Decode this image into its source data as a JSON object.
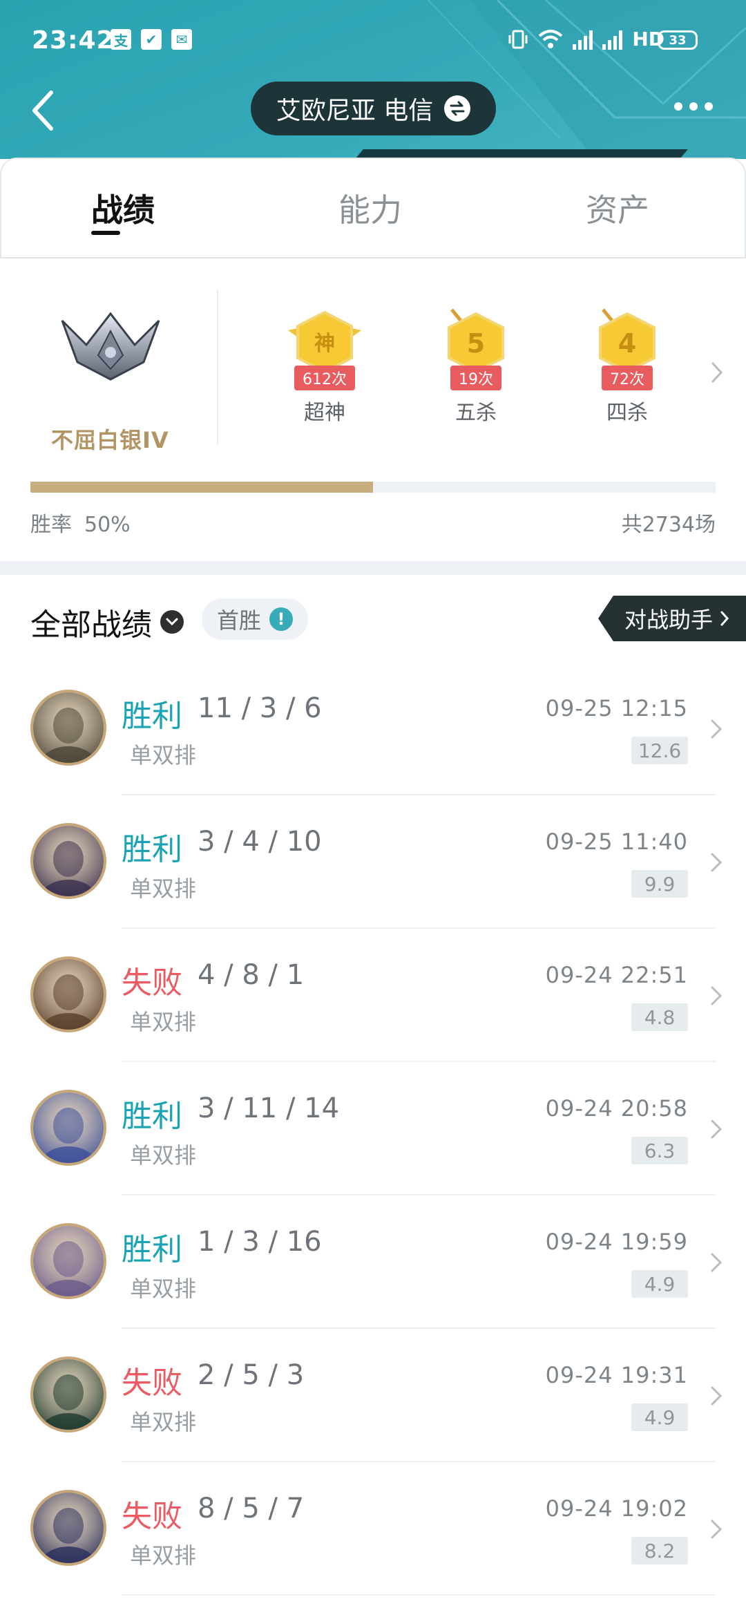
{
  "status_bar": {
    "time": "23:42",
    "apps": [
      "支",
      "✔",
      "✉"
    ],
    "net_label": "HD",
    "battery": "33"
  },
  "header": {
    "server": "艾欧尼亚 电信"
  },
  "tabs": [
    {
      "label": "战绩",
      "active": true
    },
    {
      "label": "能力",
      "active": false
    },
    {
      "label": "资产",
      "active": false
    }
  ],
  "rank": {
    "name": "不屈白银IV",
    "badges": [
      {
        "glyph": "神",
        "count": "612次",
        "label": "超神"
      },
      {
        "glyph": "5",
        "count": "19次",
        "label": "五杀"
      },
      {
        "glyph": "4",
        "count": "72次",
        "label": "四杀"
      }
    ],
    "winrate_label": "胜率",
    "winrate_value": "50%",
    "winrate_fraction": 0.5,
    "total": "共2734场"
  },
  "filter": {
    "title": "全部战绩",
    "first_win": "首胜",
    "assistant": "对战助手"
  },
  "matches": [
    {
      "result": "胜利",
      "win": true,
      "kda": "11 / 3 / 6",
      "mode": "单双排",
      "time": "09-25 12:15",
      "score": "12.6",
      "avatar_color": "#4a4536"
    },
    {
      "result": "胜利",
      "win": true,
      "kda": "3 / 4 / 10",
      "mode": "单双排",
      "time": "09-25 11:40",
      "score": "9.9",
      "avatar_color": "#3a2f4d"
    },
    {
      "result": "失败",
      "win": false,
      "kda": "4 / 8 / 1",
      "mode": "单双排",
      "time": "09-24 22:51",
      "score": "4.8",
      "avatar_color": "#5a3e2a"
    },
    {
      "result": "胜利",
      "win": true,
      "kda": "3 / 11 / 14",
      "mode": "单双排",
      "time": "09-24 20:58",
      "score": "6.3",
      "avatar_color": "#3c4f9a"
    },
    {
      "result": "胜利",
      "win": true,
      "kda": "1 / 3 / 16",
      "mode": "单双排",
      "time": "09-24 19:59",
      "score": "4.9",
      "avatar_color": "#6a5a8a"
    },
    {
      "result": "失败",
      "win": false,
      "kda": "2 / 5 / 3",
      "mode": "单双排",
      "time": "09-24 19:31",
      "score": "4.9",
      "avatar_color": "#1e3a2e"
    },
    {
      "result": "失败",
      "win": false,
      "kda": "8 / 5 / 7",
      "mode": "单双排",
      "time": "09-24 19:02",
      "score": "8.2",
      "avatar_color": "#2a2f5c"
    }
  ],
  "colors": {
    "accent": "#2aa3b1",
    "win": "#1aa3b5",
    "lose": "#ec5b61",
    "gold": "#b39565"
  }
}
